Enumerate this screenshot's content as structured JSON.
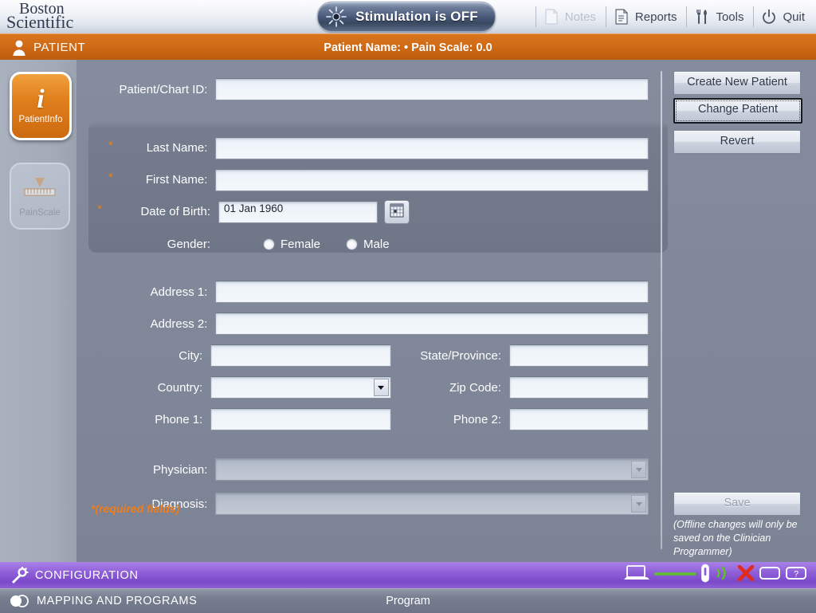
{
  "brand": {
    "line1": "Boston",
    "line2": "Scientific"
  },
  "stimulation": {
    "label": "Stimulation is OFF",
    "icon": "sunburst-icon"
  },
  "toolbar": {
    "items": [
      {
        "label": "Notes",
        "icon": "notes-icon",
        "enabled": false
      },
      {
        "label": "Reports",
        "icon": "reports-icon",
        "enabled": true
      },
      {
        "label": "Tools",
        "icon": "tools-icon",
        "enabled": true
      },
      {
        "label": "Quit",
        "icon": "power-icon",
        "enabled": true
      }
    ]
  },
  "patient_bar": {
    "section": "PATIENT",
    "icon": "person-icon",
    "info": "Patient Name:  •  Pain Scale: 0.0"
  },
  "sidebar": {
    "items": [
      {
        "label": "PatientInfo",
        "icon": "info-italic-icon",
        "active": true
      },
      {
        "label": "PainScale",
        "icon": "pain-scale-icon",
        "active": false
      }
    ]
  },
  "form": {
    "patient_chart_id": {
      "label": "Patient/Chart ID:",
      "value": ""
    },
    "last_name": {
      "label": "Last Name:",
      "value": "",
      "required": true
    },
    "first_name": {
      "label": "First Name:",
      "value": "",
      "required": true
    },
    "dob": {
      "label": "Date of Birth:",
      "value": "01 Jan 1960",
      "required": true
    },
    "calendar_icon": "calendar-icon",
    "gender": {
      "label": "Gender:",
      "options": [
        "Female",
        "Male"
      ],
      "selected": ""
    },
    "address1": {
      "label": "Address 1:",
      "value": ""
    },
    "address2": {
      "label": "Address 2:",
      "value": ""
    },
    "city": {
      "label": "City:",
      "value": ""
    },
    "state": {
      "label": "State/Province:",
      "value": ""
    },
    "country": {
      "label": "Country:",
      "value": ""
    },
    "zip": {
      "label": "Zip Code:",
      "value": ""
    },
    "phone1": {
      "label": "Phone 1:",
      "value": ""
    },
    "phone2": {
      "label": "Phone 2:",
      "value": ""
    },
    "physician": {
      "label": "Physician:",
      "value": "",
      "enabled": false
    },
    "diagnosis": {
      "label": "Diagnosis:",
      "value": "",
      "enabled": false
    },
    "required_note": "*(required fields)"
  },
  "actions": {
    "create_new_patient": "Create New Patient",
    "change_patient": "Change Patient",
    "revert": "Revert",
    "save": "Save",
    "save_enabled": false,
    "offline_note": "(Offline changes will only be saved on the Clinician Programmer)"
  },
  "config_bar": {
    "label": "CONFIGURATION",
    "icon": "gear-wand-icon",
    "status_icons": [
      "laptop-icon",
      "link-line-icon",
      "remote-wand-icon",
      "rf-signal-icon",
      "red-x-icon",
      "battery-empty-icon",
      "battery-unknown-icon"
    ]
  },
  "mapping_bar": {
    "label": "MAPPING AND PROGRAMS",
    "icon": "two-circles-icon",
    "program": "Program"
  },
  "colors": {
    "accent_orange": "#cf6a15",
    "required_star": "#f07d1a",
    "config_purple": "#8f5fd8",
    "body_blue_grey": "#7f8799",
    "signal_green": "#5fbf2a",
    "alert_red": "#e02b20"
  }
}
